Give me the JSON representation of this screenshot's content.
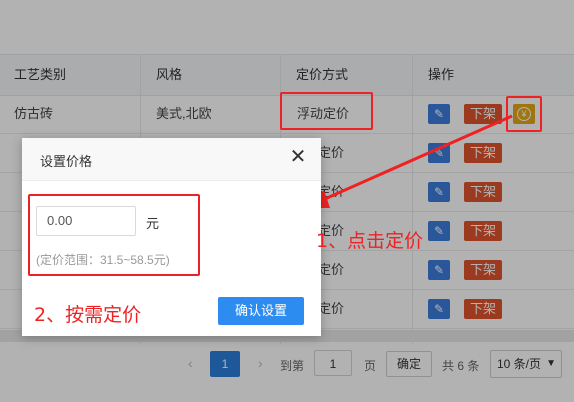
{
  "table": {
    "headers": [
      "工艺类别",
      "风格",
      "定价方式",
      "操作"
    ],
    "rows": [
      {
        "craft": "仿古砖",
        "style": "美式,北欧",
        "pricing": "浮动定价"
      },
      {
        "craft": "",
        "style": "",
        "pricing": "定价"
      },
      {
        "craft": "",
        "style": "",
        "pricing": "定价"
      },
      {
        "craft": "",
        "style": "",
        "pricing": "定价"
      },
      {
        "craft": "",
        "style": "",
        "pricing": "定价"
      },
      {
        "craft": "",
        "style": "",
        "pricing": "定价"
      }
    ],
    "edit_icon": "pencil-icon",
    "off_label": "下架",
    "price_icon": "yen-coin-icon",
    "price_glyph": "¥"
  },
  "pager": {
    "prev": "‹",
    "current": "1",
    "next": "›",
    "goto_label": "到第",
    "page_input": "1",
    "page_unit": "页",
    "go_button": "确定",
    "total": "共 6 条",
    "page_size": "10 条/页",
    "page_size_icon": "chevron-down-icon"
  },
  "dialog": {
    "title": "设置价格",
    "close_glyph": "✕",
    "price_placeholder": "0.00",
    "unit": "元",
    "range_text": "(定价范围：31.5~58.5元)",
    "confirm_label": "确认设置"
  },
  "annotations": {
    "step1": "1、点击定价",
    "step2": "2、按需定价",
    "color": "#ee2222"
  },
  "colors": {
    "primary": "#2d8cf0",
    "edit": "#3b7ddd",
    "off": "#e0542e",
    "price": "#e6a817"
  }
}
